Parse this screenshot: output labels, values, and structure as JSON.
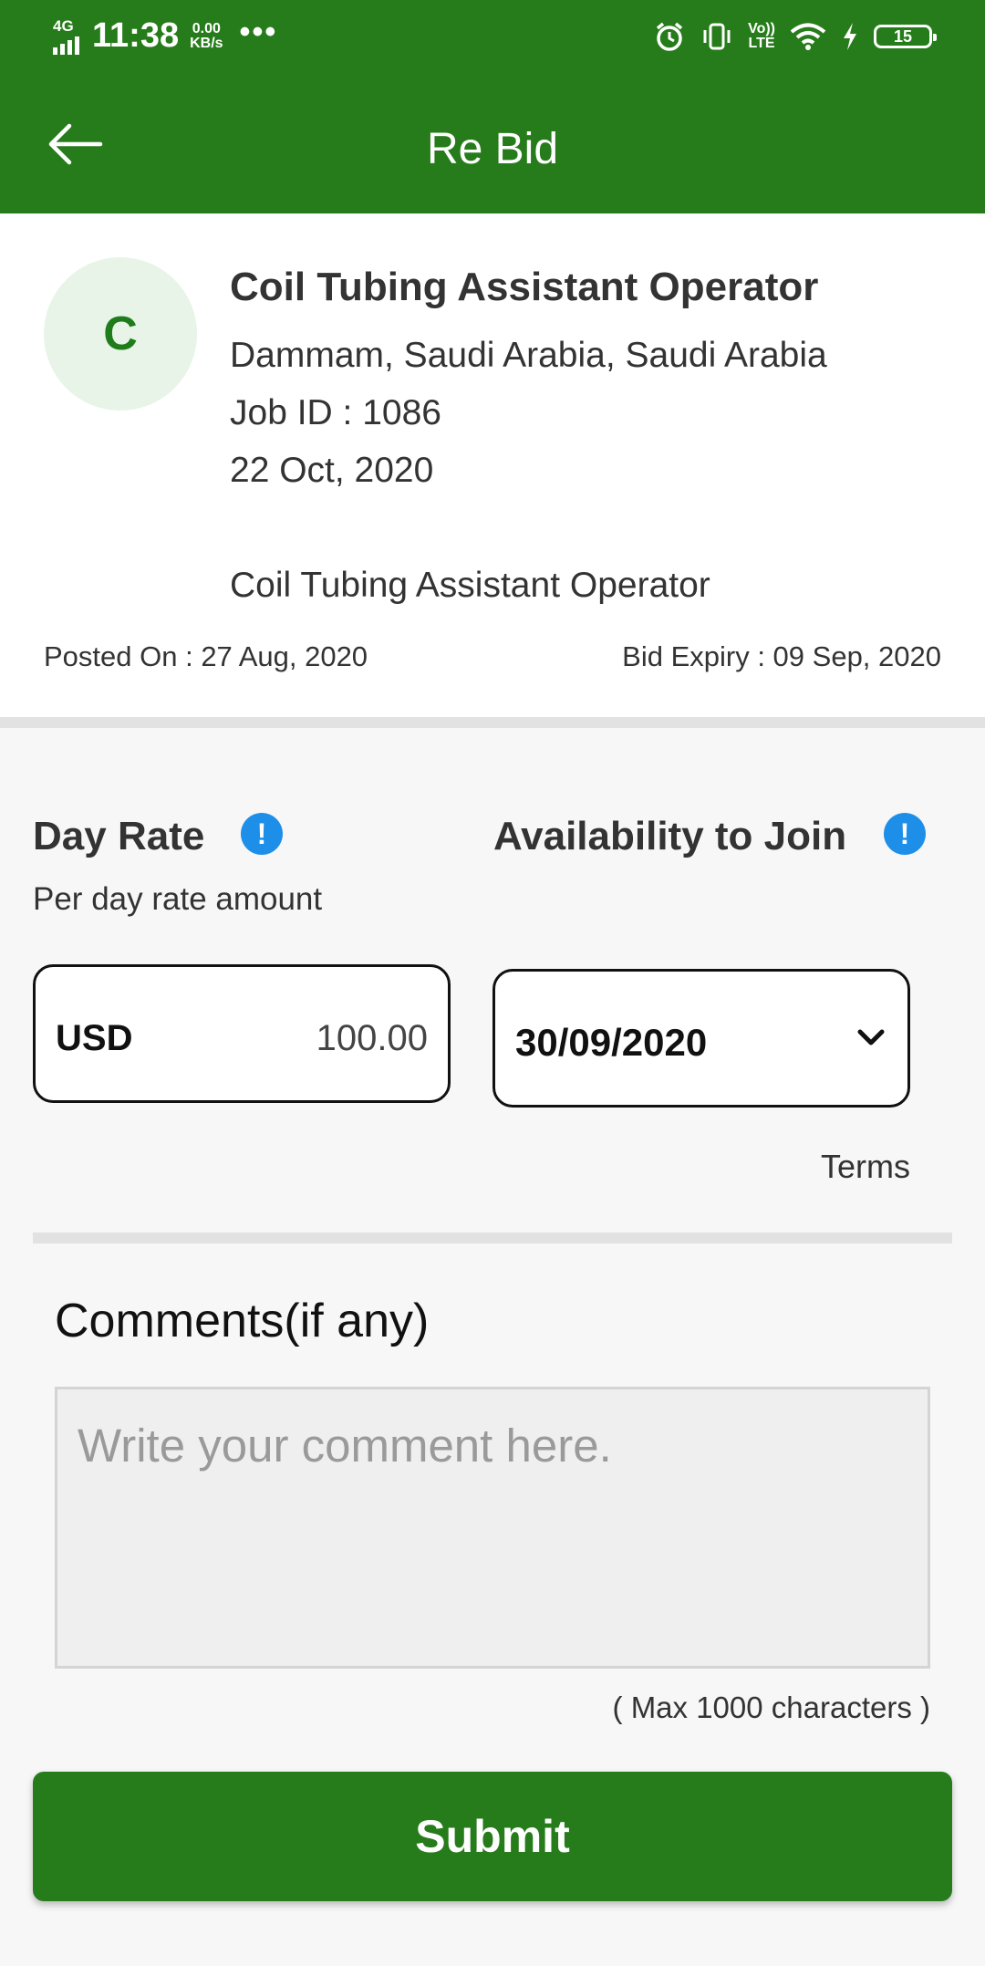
{
  "status_bar": {
    "network": "4G",
    "time": "11:38",
    "speed_value": "0.00",
    "speed_unit": "KB/s",
    "more": "•••",
    "volte_top": "Vo))",
    "volte_bottom": "LTE",
    "battery_level": "15",
    "icons": [
      "alarm-icon",
      "vibrate-icon",
      "volte-icon",
      "wifi-icon",
      "charging-icon",
      "battery-icon"
    ]
  },
  "header": {
    "title": "Re Bid",
    "back_icon": "arrow-left-icon",
    "color": "#267c1a"
  },
  "job": {
    "avatar_letter": "C",
    "title": "Coil Tubing Assistant Operator",
    "location": "Dammam, Saudi Arabia, Saudi Arabia",
    "job_id": "Job ID : 1086",
    "date": "22 Oct, 2020",
    "description": "Coil Tubing Assistant Operator",
    "posted_on": "Posted On : 27 Aug, 2020",
    "bid_expiry": "Bid Expiry : 09 Sep, 2020"
  },
  "bid": {
    "day_rate_label": "Day Rate",
    "day_rate_sub": "Per day rate amount",
    "currency": "USD",
    "amount": "100.00",
    "availability_label": "Availability to Join",
    "availability_date": "30/09/2020",
    "terms_label": "Terms",
    "info_glyph": "!",
    "info_color": "#1e8fe9"
  },
  "comments": {
    "label": "Comments(if any)",
    "placeholder": "Write your comment here.",
    "max_chars": "( Max 1000 characters )"
  },
  "submit_label": "Submit"
}
